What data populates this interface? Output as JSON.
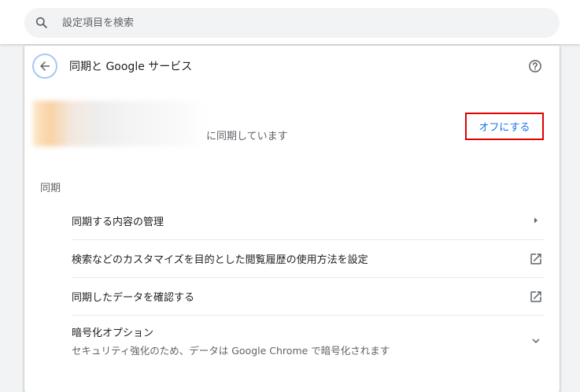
{
  "search": {
    "placeholder": "設定項目を検索",
    "icon": "search-icon"
  },
  "header": {
    "title": "同期と Google サービス",
    "back_icon": "arrow-back-icon",
    "help_icon": "help-icon"
  },
  "account": {
    "sync_status": "に同期しています",
    "off_button_label": "オフにする"
  },
  "sync_section": {
    "title": "同期",
    "items": [
      {
        "label": "同期する内容の管理",
        "icon": "chevron-right-icon"
      },
      {
        "label": "検索などのカスタマイズを目的とした閲覧履歴の使用方法を設定",
        "icon": "open-in-new-icon"
      },
      {
        "label": "同期したデータを確認する",
        "icon": "open-in-new-icon"
      },
      {
        "label": "暗号化オプション",
        "sublabel": "セキュリティ強化のため、データは Google Chrome で暗号化されます",
        "icon": "expand-more-icon"
      }
    ]
  },
  "colors": {
    "accent": "#1a73e8",
    "highlight_border": "#e00000",
    "text_secondary": "#5f6368"
  }
}
